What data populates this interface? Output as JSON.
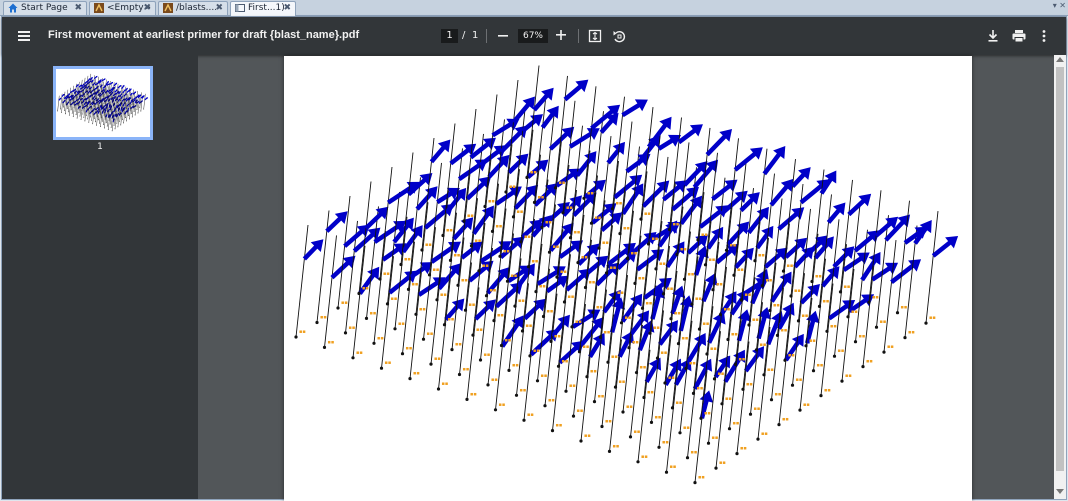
{
  "tabs": [
    {
      "label": "Start Page",
      "icon": "home-icon",
      "active": false
    },
    {
      "label": "<Empty>",
      "icon": "app-icon",
      "active": false
    },
    {
      "label": "/blasts....",
      "icon": "app-icon",
      "active": false
    },
    {
      "label": "First...1)",
      "icon": "document-icon",
      "active": true
    }
  ],
  "toolbar": {
    "title": "First movement at earliest primer for draft {blast_name}.pdf",
    "current_page": "1",
    "page_separator": "/",
    "total_pages": "1",
    "zoom": "67%"
  },
  "sidebar": {
    "thumbnail_label": "1"
  },
  "colors": {
    "toolbar_bg": "#323639",
    "viewer_bg": "#525659",
    "arrow": "#0000c8",
    "label": "#f0a020",
    "accent": "#8ab4f8"
  },
  "icons": [
    "menu-icon",
    "zoom-out-icon",
    "zoom-in-icon",
    "fit-page-icon",
    "rotate-icon",
    "download-icon",
    "print-icon",
    "more-icon"
  ]
}
